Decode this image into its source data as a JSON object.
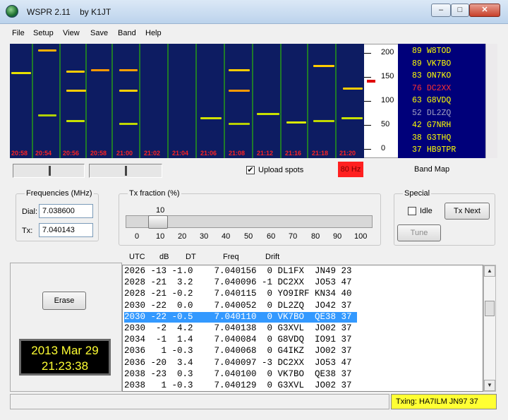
{
  "window": {
    "title": "WSPR 2.11    by K1JT",
    "minimize": "–",
    "maximize": "□",
    "close": "✕"
  },
  "menu": [
    "File",
    "Setup",
    "View",
    "Save",
    "Band",
    "Help"
  ],
  "waterfall": {
    "times": [
      "20:58",
      "20:54",
      "20:56",
      "20:58",
      "21:00",
      "21:02",
      "21:04",
      "21:06",
      "21:08",
      "21:12",
      "21:16",
      "21:18",
      "21:20"
    ],
    "hz_label": "80 Hz"
  },
  "scale": {
    "ticks": [
      "200",
      "150",
      "100",
      "50",
      "0"
    ]
  },
  "band_map": {
    "entries": [
      {
        "snr": "89",
        "call": "W8TOD",
        "color": "#ffff00"
      },
      {
        "snr": "89",
        "call": "VK7BO",
        "color": "#ffff00"
      },
      {
        "snr": "83",
        "call": "ON7KO",
        "color": "#ffff00"
      },
      {
        "snr": "76",
        "call": "DC2XX",
        "color": "#ff3030"
      },
      {
        "snr": "63",
        "call": "G8VDQ",
        "color": "#ffff00"
      },
      {
        "snr": "52",
        "call": "DL2ZQ",
        "color": "#a0a0c0"
      },
      {
        "snr": "42",
        "call": "G7NRH",
        "color": "#ffff00"
      },
      {
        "snr": "38",
        "call": "G3THQ",
        "color": "#ffff00"
      },
      {
        "snr": "37",
        "call": "HB9TPR",
        "color": "#ffff00"
      }
    ],
    "label": "Band Map"
  },
  "upload_spots": {
    "label": "Upload spots",
    "checked": "✔"
  },
  "frequencies": {
    "group_title": "Frequencies (MHz)",
    "dial_label": "Dial:",
    "dial_value": "7.038600",
    "tx_label": "Tx:",
    "tx_value": "7.040143"
  },
  "tx_fraction": {
    "group_title": "Tx fraction (%)",
    "current": "10",
    "value_percent": 10,
    "scale": [
      "0",
      "10",
      "20",
      "30",
      "40",
      "50",
      "60",
      "70",
      "80",
      "90",
      "100"
    ]
  },
  "special": {
    "group_title": "Special",
    "idle_label": "Idle",
    "tx_next_label": "Tx Next",
    "tune_label": "Tune"
  },
  "decode_headers": {
    "utc": "UTC",
    "db": "dB",
    "dt": "DT",
    "freq": "Freq",
    "drift": "Drift"
  },
  "decodes": [
    "2026 -13 -1.0    7.040156  0 DL1FX  JN49 23",
    "2028 -21  3.2    7.040096 -1 DC2XX  JO53 47",
    "2028 -21 -0.2    7.040115  0 YO9IRF KN34 40",
    "2030 -22  0.0    7.040052  0 DL2ZQ  JO42 37",
    "2030 -22 -0.5    7.040110  0 VK7BO  QE38 37",
    "2030  -2  4.2    7.040138  0 G3XVL  JO02 37",
    "2034  -1  1.4    7.040084  0 G8VDQ  IO91 37",
    "2036   1 -0.3    7.040068  0 G4IKZ  JO02 37",
    "2036 -20  3.4    7.040097 -3 DC2XX  JO53 47",
    "2038 -23  0.3    7.040100  0 VK7BO  QE38 37",
    "2038   1 -0.3    7.040129  0 G3XVL  JO02 37"
  ],
  "selected_decode": 4,
  "erase_label": "Erase",
  "clock": {
    "date": "2013 Mar 29",
    "time": "21:23:38"
  },
  "status": {
    "txing": "Txing: HA7ILM JN97 37"
  }
}
